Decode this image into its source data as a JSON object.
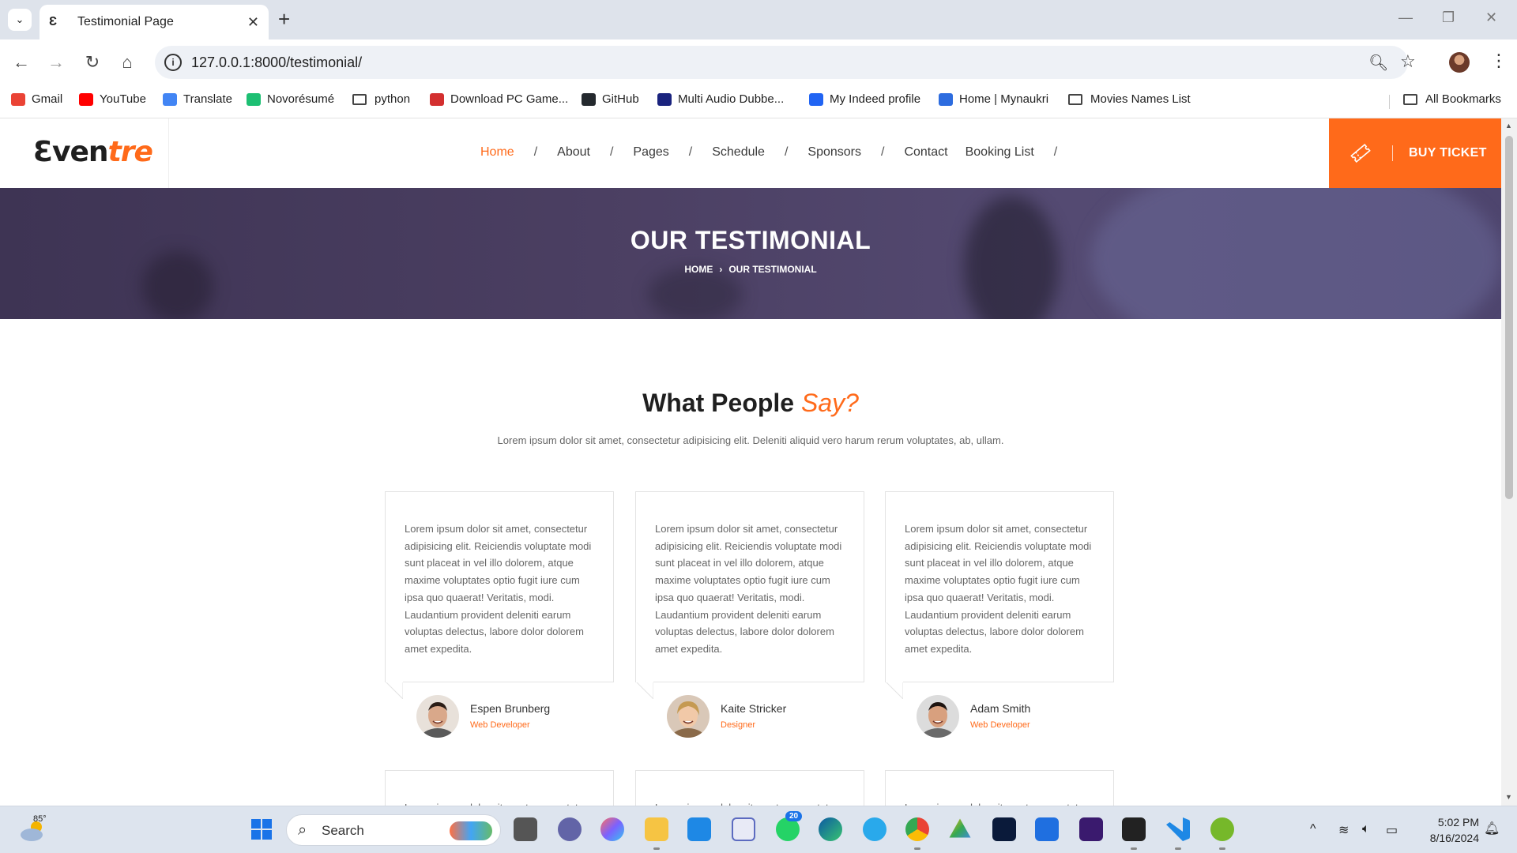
{
  "browser": {
    "tab_title": "Testimonial Page",
    "tab_favicon": "Ɛ",
    "url": "127.0.0.1:8000/testimonial/",
    "bookmarks": [
      {
        "label": "Gmail",
        "icon": "gmail-icon",
        "color": "#ea4335"
      },
      {
        "label": "YouTube",
        "icon": "youtube-icon",
        "color": "#ff0000"
      },
      {
        "label": "Translate",
        "icon": "translate-icon",
        "color": "#4285f4"
      },
      {
        "label": "Novorésumé",
        "icon": "novoresume-icon",
        "color": "#1dbf73"
      },
      {
        "label": "python",
        "icon": "folder-icon",
        "color": "#444444"
      },
      {
        "label": "Download PC Game...",
        "icon": "game-icon",
        "color": "#d32f2f"
      },
      {
        "label": "GitHub",
        "icon": "github-icon",
        "color": "#24292e"
      },
      {
        "label": "Multi Audio Dubbe...",
        "icon": "movie-icon",
        "color": "#1a237e"
      },
      {
        "label": "My Indeed profile",
        "icon": "indeed-icon",
        "color": "#2164f3"
      },
      {
        "label": "Home | Mynaukri",
        "icon": "naukri-icon",
        "color": "#2d6cdf"
      },
      {
        "label": "Movies Names List",
        "icon": "folder-icon",
        "color": "#444444"
      }
    ],
    "all_bookmarks": "All Bookmarks"
  },
  "site": {
    "logo_main": "Ɛven",
    "logo_accent": "tre",
    "nav": [
      "Home",
      "About",
      "Pages",
      "Schedule",
      "Sponsors",
      "Contact",
      "Booking List"
    ],
    "nav_separator": "/",
    "buy_ticket": "BUY TICKET",
    "accent_color": "#ff6a1a"
  },
  "hero": {
    "title": "OUR TESTIMONIAL",
    "breadcrumb_home": "HOME",
    "breadcrumb_sep": "›",
    "breadcrumb_current": "OUR TESTIMONIAL"
  },
  "section": {
    "title_main": "What People",
    "title_accent": "Say?",
    "subtitle": "Lorem ipsum dolor sit amet, consectetur adipisicing elit. Deleniti aliquid vero harum rerum voluptates, ab, ullam."
  },
  "testimonials": [
    {
      "text": "Lorem ipsum dolor sit amet, consectetur adipisicing elit. Reiciendis voluptate modi sunt placeat in vel illo dolorem, atque maxime voluptates optio fugit iure cum ipsa quo quaerat! Veritatis, modi. Laudantium provident deleniti earum voluptas delectus, labore dolor dolorem amet expedita.",
      "name": "Espen Brunberg",
      "role": "Web Developer"
    },
    {
      "text": "Lorem ipsum dolor sit amet, consectetur adipisicing elit. Reiciendis voluptate modi sunt placeat in vel illo dolorem, atque maxime voluptates optio fugit iure cum ipsa quo quaerat! Veritatis, modi. Laudantium provident deleniti earum voluptas delectus, labore dolor dolorem amet expedita.",
      "name": "Kaite Stricker",
      "role": "Designer"
    },
    {
      "text": "Lorem ipsum dolor sit amet, consectetur adipisicing elit. Reiciendis voluptate modi sunt placeat in vel illo dolorem, atque maxime voluptates optio fugit iure cum ipsa quo quaerat! Veritatis, modi. Laudantium provident deleniti earum voluptas delectus, labore dolor dolorem amet expedita.",
      "name": "Adam Smith",
      "role": "Web Developer"
    }
  ],
  "partial_row_text": "Lorem ipsum dolor sit amet, consectetur",
  "taskbar": {
    "weather_temp": "85°",
    "search_label": "Search",
    "whatsapp_badge": "20",
    "time": "5:02 PM",
    "date": "8/16/2024"
  }
}
